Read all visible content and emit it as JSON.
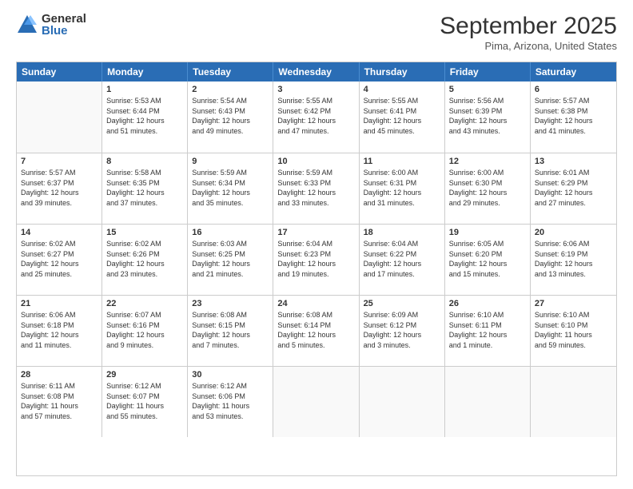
{
  "logo": {
    "general": "General",
    "blue": "Blue"
  },
  "title": "September 2025",
  "location": "Pima, Arizona, United States",
  "days": [
    "Sunday",
    "Monday",
    "Tuesday",
    "Wednesday",
    "Thursday",
    "Friday",
    "Saturday"
  ],
  "weeks": [
    [
      {
        "day": "",
        "info": ""
      },
      {
        "day": "1",
        "info": "Sunrise: 5:53 AM\nSunset: 6:44 PM\nDaylight: 12 hours\nand 51 minutes."
      },
      {
        "day": "2",
        "info": "Sunrise: 5:54 AM\nSunset: 6:43 PM\nDaylight: 12 hours\nand 49 minutes."
      },
      {
        "day": "3",
        "info": "Sunrise: 5:55 AM\nSunset: 6:42 PM\nDaylight: 12 hours\nand 47 minutes."
      },
      {
        "day": "4",
        "info": "Sunrise: 5:55 AM\nSunset: 6:41 PM\nDaylight: 12 hours\nand 45 minutes."
      },
      {
        "day": "5",
        "info": "Sunrise: 5:56 AM\nSunset: 6:39 PM\nDaylight: 12 hours\nand 43 minutes."
      },
      {
        "day": "6",
        "info": "Sunrise: 5:57 AM\nSunset: 6:38 PM\nDaylight: 12 hours\nand 41 minutes."
      }
    ],
    [
      {
        "day": "7",
        "info": "Sunrise: 5:57 AM\nSunset: 6:37 PM\nDaylight: 12 hours\nand 39 minutes."
      },
      {
        "day": "8",
        "info": "Sunrise: 5:58 AM\nSunset: 6:35 PM\nDaylight: 12 hours\nand 37 minutes."
      },
      {
        "day": "9",
        "info": "Sunrise: 5:59 AM\nSunset: 6:34 PM\nDaylight: 12 hours\nand 35 minutes."
      },
      {
        "day": "10",
        "info": "Sunrise: 5:59 AM\nSunset: 6:33 PM\nDaylight: 12 hours\nand 33 minutes."
      },
      {
        "day": "11",
        "info": "Sunrise: 6:00 AM\nSunset: 6:31 PM\nDaylight: 12 hours\nand 31 minutes."
      },
      {
        "day": "12",
        "info": "Sunrise: 6:00 AM\nSunset: 6:30 PM\nDaylight: 12 hours\nand 29 minutes."
      },
      {
        "day": "13",
        "info": "Sunrise: 6:01 AM\nSunset: 6:29 PM\nDaylight: 12 hours\nand 27 minutes."
      }
    ],
    [
      {
        "day": "14",
        "info": "Sunrise: 6:02 AM\nSunset: 6:27 PM\nDaylight: 12 hours\nand 25 minutes."
      },
      {
        "day": "15",
        "info": "Sunrise: 6:02 AM\nSunset: 6:26 PM\nDaylight: 12 hours\nand 23 minutes."
      },
      {
        "day": "16",
        "info": "Sunrise: 6:03 AM\nSunset: 6:25 PM\nDaylight: 12 hours\nand 21 minutes."
      },
      {
        "day": "17",
        "info": "Sunrise: 6:04 AM\nSunset: 6:23 PM\nDaylight: 12 hours\nand 19 minutes."
      },
      {
        "day": "18",
        "info": "Sunrise: 6:04 AM\nSunset: 6:22 PM\nDaylight: 12 hours\nand 17 minutes."
      },
      {
        "day": "19",
        "info": "Sunrise: 6:05 AM\nSunset: 6:20 PM\nDaylight: 12 hours\nand 15 minutes."
      },
      {
        "day": "20",
        "info": "Sunrise: 6:06 AM\nSunset: 6:19 PM\nDaylight: 12 hours\nand 13 minutes."
      }
    ],
    [
      {
        "day": "21",
        "info": "Sunrise: 6:06 AM\nSunset: 6:18 PM\nDaylight: 12 hours\nand 11 minutes."
      },
      {
        "day": "22",
        "info": "Sunrise: 6:07 AM\nSunset: 6:16 PM\nDaylight: 12 hours\nand 9 minutes."
      },
      {
        "day": "23",
        "info": "Sunrise: 6:08 AM\nSunset: 6:15 PM\nDaylight: 12 hours\nand 7 minutes."
      },
      {
        "day": "24",
        "info": "Sunrise: 6:08 AM\nSunset: 6:14 PM\nDaylight: 12 hours\nand 5 minutes."
      },
      {
        "day": "25",
        "info": "Sunrise: 6:09 AM\nSunset: 6:12 PM\nDaylight: 12 hours\nand 3 minutes."
      },
      {
        "day": "26",
        "info": "Sunrise: 6:10 AM\nSunset: 6:11 PM\nDaylight: 12 hours\nand 1 minute."
      },
      {
        "day": "27",
        "info": "Sunrise: 6:10 AM\nSunset: 6:10 PM\nDaylight: 11 hours\nand 59 minutes."
      }
    ],
    [
      {
        "day": "28",
        "info": "Sunrise: 6:11 AM\nSunset: 6:08 PM\nDaylight: 11 hours\nand 57 minutes."
      },
      {
        "day": "29",
        "info": "Sunrise: 6:12 AM\nSunset: 6:07 PM\nDaylight: 11 hours\nand 55 minutes."
      },
      {
        "day": "30",
        "info": "Sunrise: 6:12 AM\nSunset: 6:06 PM\nDaylight: 11 hours\nand 53 minutes."
      },
      {
        "day": "",
        "info": ""
      },
      {
        "day": "",
        "info": ""
      },
      {
        "day": "",
        "info": ""
      },
      {
        "day": "",
        "info": ""
      }
    ]
  ]
}
